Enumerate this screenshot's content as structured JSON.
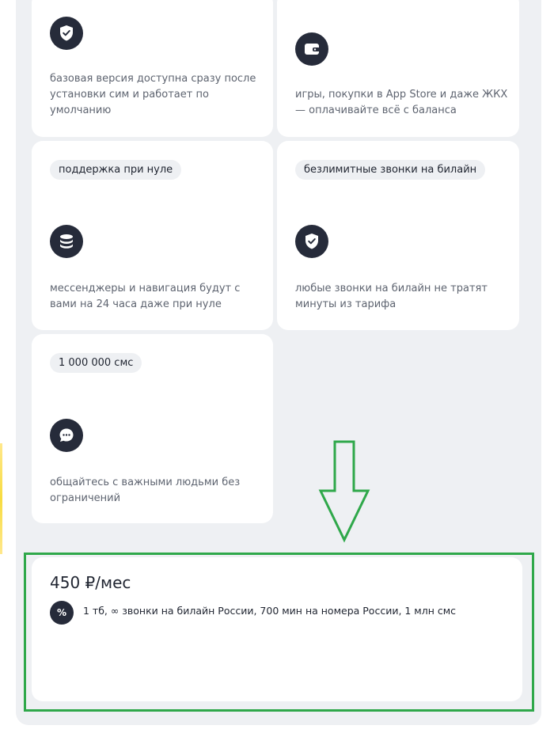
{
  "cards": [
    {
      "chip": "",
      "icon": "shield-check-icon",
      "text": "базовая версия доступна сразу после установки сим и работает по умолчанию"
    },
    {
      "chip": "",
      "icon": "wallet-icon",
      "text": "игры, покупки в App Store и даже ЖКХ — оплачивайте всё с баланса"
    },
    {
      "chip": "поддержка при нуле",
      "icon": "database-icon",
      "text": "мессенджеры и навигация будут с вами на 24 часа даже при нуле"
    },
    {
      "chip": "безлимитные звонки на билайн",
      "icon": "shield-check-icon",
      "text": "любые звонки на билайн не тратят минуты из тарифа"
    },
    {
      "chip": "1 000 000 смс",
      "icon": "chat-bubble-icon",
      "text": "общайтесь с важными людьми без ограничений"
    }
  ],
  "tariff": {
    "price": "450 ₽/мес",
    "icon": "percent-icon",
    "icon_glyph": "%",
    "description": "1 тб, ∞ звонки на билайн России, 700 мин на номера России, 1 млн смс"
  },
  "annotation": {
    "highlight_color": "#2fa84a",
    "arrow": "down-arrow-outline"
  }
}
